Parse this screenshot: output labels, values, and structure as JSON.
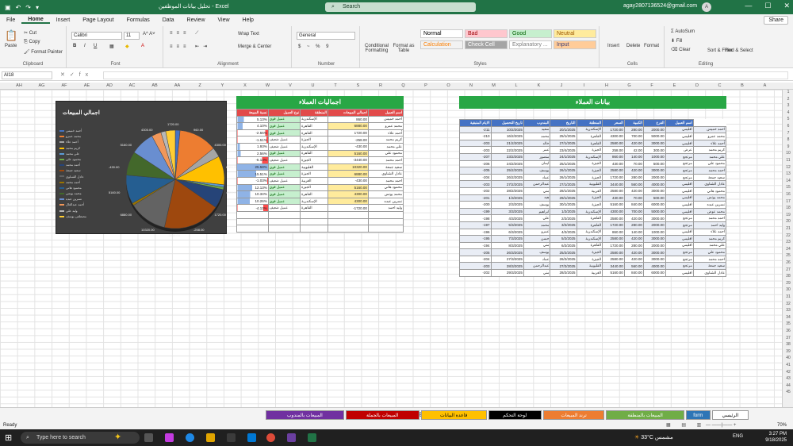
{
  "window": {
    "title": "تحليل بيانات الموظفين - Excel",
    "search": "Search",
    "account": "agay2807136524@gmail.com",
    "avatar": "A"
  },
  "menu": [
    "File",
    "Home",
    "Insert",
    "Page Layout",
    "Formulas",
    "Data",
    "Review",
    "View",
    "Help"
  ],
  "share": "Share",
  "ribbon": {
    "clipboard": {
      "label": "Clipboard",
      "paste": "Paste",
      "cut": "Cut",
      "copy": "Copy",
      "painter": "Format Painter"
    },
    "font": {
      "label": "Font",
      "name": "Calibri",
      "size": "11"
    },
    "alignment": {
      "label": "Alignment",
      "wrap": "Wrap Text",
      "merge": "Merge & Center"
    },
    "number": {
      "label": "Number",
      "format": "General",
      "symbols": "$ ~ % 9"
    },
    "styles": {
      "label": "Styles",
      "cond": "Conditional Formatting",
      "table": "Format as Table",
      "items": [
        {
          "t": "Normal",
          "bg": "#ffffff",
          "c": "#000000"
        },
        {
          "t": "Bad",
          "bg": "#ffc7ce",
          "c": "#9c0006"
        },
        {
          "t": "Good",
          "bg": "#c6efce",
          "c": "#006100"
        },
        {
          "t": "Neutral",
          "bg": "#ffeb9c",
          "c": "#9c5700"
        },
        {
          "t": "Calculation",
          "bg": "#f2f2f2",
          "c": "#fa7d00"
        },
        {
          "t": "Check Cell",
          "bg": "#a5a5a5",
          "c": "#ffffff"
        },
        {
          "t": "Explanatory ...",
          "bg": "#ffffff",
          "c": "#7f7f7f"
        },
        {
          "t": "Input",
          "bg": "#ffcc99",
          "c": "#3f3f76"
        }
      ]
    },
    "cells": {
      "label": "Cells",
      "insert": "Insert",
      "delete": "Delete",
      "format": "Format"
    },
    "editing": {
      "label": "Editing",
      "autosum": "AutoSum",
      "fill": "Fill",
      "clear": "Clear",
      "sort": "Sort & Filter",
      "find": "Find & Select"
    }
  },
  "namebox": "AI18",
  "columns": [
    "AH",
    "AG",
    "AF",
    "AE",
    "AD",
    "AC",
    "AB",
    "AA",
    "Z",
    "Y",
    "X",
    "W",
    "V",
    "U",
    "T",
    "S",
    "R",
    "Q",
    "P",
    "O",
    "N",
    "M",
    "L",
    "K",
    "J",
    "I",
    "H",
    "G",
    "F",
    "E",
    "D",
    "C",
    "B",
    "A"
  ],
  "rows": [
    "1",
    "2",
    "3",
    "4",
    "5",
    "6",
    "7",
    "8",
    "9",
    "10",
    "11",
    "12",
    "13",
    "14",
    "15",
    "16",
    "17",
    "18",
    "19",
    "20",
    "21",
    "22",
    "23",
    "24",
    "25",
    "26",
    "27",
    "28",
    "29",
    "30",
    "31",
    "32",
    "33",
    "34",
    "35",
    "36",
    "37",
    "38",
    "39",
    "40",
    "41",
    "42",
    "43",
    "44",
    "45"
  ],
  "chart": {
    "title": "اجمالي المبيعات",
    "legend": [
      "أحمد خميس",
      "محمد عمرو",
      "أحمد علاء",
      "كريم محمد",
      "علي محمد",
      "محمود علي",
      "أحمد محمد",
      "سعيد جمعة",
      "عادل الشناوي",
      "أحمد محمد",
      "محمود هاني",
      "محمد يونس",
      "نسرين عبده",
      "أحمد عبدالعال",
      "وليد علي",
      "مصطفى يوسف"
    ],
    "labels": [
      "1720.00",
      "960.00",
      "4300.00",
      "6880.00",
      "4300.00",
      "1720.00",
      "-258.00",
      "-3440.00",
      "10320.00",
      "6880.00",
      "5160.00",
      "-430.00",
      "5160.00",
      "4300.00"
    ]
  },
  "chart_data": {
    "type": "pie",
    "title": "اجمالي المبيعات",
    "categories": [
      "1",
      "2",
      "3",
      "4",
      "5",
      "6",
      "7",
      "8",
      "9",
      "10",
      "11",
      "12",
      "13",
      "14",
      "15",
      "16"
    ],
    "values": [
      860,
      6880,
      1720,
      5160,
      430,
      430,
      3440,
      10320,
      6880,
      430,
      5160,
      4300,
      4300,
      1720,
      860,
      1720
    ]
  },
  "summary": {
    "title": "اجماليات العملاء",
    "headers": [
      "اسم العميل",
      "اجمالي المبيعات",
      "المنطقة",
      "نوع العميل",
      "نسبة المبيعة"
    ],
    "rows": [
      [
        "احمد خميس",
        "860.00",
        "الإسكندرية",
        "عميل قوي",
        "5.13%"
      ],
      [
        "محمد عمرو",
        "6880.00",
        "القاهرة",
        "عميل قوي",
        "4.10%"
      ],
      [
        "أحمد علاء",
        "1720.00",
        "القاهرة",
        "عميل قوي",
        "-2.56%"
      ],
      [
        "كريم محمد",
        "-258.00",
        "الجيزة",
        "عميل ضعيف",
        "-1.51%"
      ],
      [
        "علي محمد",
        "-430.00",
        "الإسكندرية",
        "عميل ضعيف",
        "1.93%"
      ],
      [
        "محمود علي",
        "5160.00",
        "القاهرة",
        "عميل قوي",
        "2.56%"
      ],
      [
        "احمد محمد",
        "-3440.00",
        "الجيزة",
        "عميل ضعيف",
        "-5.13%"
      ],
      [
        "سعيد جمعة",
        "10320.00",
        "القليوبية",
        "عميل قوي",
        "25.58%"
      ],
      [
        "عادل الشناوي",
        "6880.00",
        "الجيزة",
        "عميل قوي",
        "15.51%"
      ],
      [
        "احمد محمد",
        "-430.00",
        "الغربية",
        "عميل ضعيف",
        "-1.03%"
      ],
      [
        "محمود هاني",
        "5160.00",
        "الجيزة",
        "عميل قوي",
        "12.13%"
      ],
      [
        "محمد يونس",
        "4300.00",
        "القاهرة",
        "عميل قوي",
        "10.34%"
      ],
      [
        "نسرين عبده",
        "4300.00",
        "الإسكندرية",
        "عميل قوي",
        "10.26%"
      ],
      [
        "وليد احمد",
        "-1720.00",
        "القاهرة",
        "عميل ضعيف",
        "-4.13%"
      ]
    ]
  },
  "customers": {
    "title": "بيانات العملاء",
    "headers": [
      "اسم العميل",
      "الفرع",
      "الكمية",
      "السعر",
      "المنطقة",
      "التاريخ",
      "المندوب",
      "تاريخ التحصيل",
      "الايام المتبقية"
    ],
    "rows": [
      [
        "احمد خميس",
        "اقليمي",
        "2000.00",
        "280.00",
        "1720.00",
        "الإسكندرية",
        "20/1/2025",
        "سعيد",
        "10/2/2025",
        "-211"
      ],
      [
        "محمد عمرو",
        "اقليمي",
        "5000.00",
        "700.00",
        "4300.00",
        "القاهرة",
        "25/1/2025",
        "محمد",
        "16/2/2025",
        "-210"
      ],
      [
        "أحمد علاء",
        "اقليمي",
        "3000.00",
        "420.00",
        "2580.00",
        "القاهرة",
        "27/1/2025",
        "خالد",
        "21/2/2025",
        "-203"
      ],
      [
        "كريم محمد",
        "عرض",
        "300.00",
        "42.00",
        "258.00",
        "الجيزة",
        "23/4/2025",
        "عمر",
        "22/2/2025",
        "-203"
      ],
      [
        "علي محمد",
        "مرتجع",
        "1000.00",
        "140.00",
        "860.00",
        "الإسكندرية",
        "24/1/2025",
        "منصور",
        "23/2/2025",
        "-207"
      ],
      [
        "محمود علي",
        "مرتجع",
        "500.00",
        "70.00",
        "430.00",
        "الجيزة",
        "25/1/2025",
        "ايمان",
        "24/2/2025",
        "-206"
      ],
      [
        "احمد محمد",
        "مرتجع",
        "3000.00",
        "420.00",
        "2580.00",
        "الجيزة",
        "26/1/2025",
        "يوسف",
        "25/2/2025",
        "-205"
      ],
      [
        "سعيد جمعة",
        "مرتجع",
        "2000.00",
        "280.00",
        "1720.00",
        "الجيزة",
        "26/1/2025",
        "عماد",
        "26/2/2025",
        "-204"
      ],
      [
        "عادل الشناوي",
        "اقليمي",
        "4000.00",
        "560.00",
        "3440.00",
        "القليوبية",
        "27/1/2025",
        "عبدالرحمن",
        "27/2/2025",
        "-203"
      ],
      [
        "محمود هاني",
        "اقليمي",
        "3000.00",
        "420.00",
        "2580.00",
        "الغربية",
        "28/1/2025",
        "مني",
        "28/2/2025",
        "-202"
      ],
      [
        "محمد يونس",
        "اقليمي",
        "500.00",
        "70.00",
        "430.00",
        "الجيزة",
        "29/1/2025",
        "هبه",
        "1/3/2025",
        "-201"
      ],
      [
        "نسرين عبده",
        "اقليمي",
        "6000.00",
        "840.00",
        "5160.00",
        "الجيزة",
        "30/1/2025",
        "يوسف",
        "2/3/2025",
        "-200"
      ],
      [
        "محمد عوض",
        "اقليمي",
        "5000.00",
        "700.00",
        "4300.00",
        "الإسكندرية",
        "1/2/2025",
        "ابراهيم",
        "3/3/2025",
        "-199"
      ],
      [
        "احمد محمد",
        "مرتجع",
        "3000.00",
        "420.00",
        "2580.00",
        "القاهرة",
        "2/2/2025",
        "علي",
        "4/3/2025",
        "-198"
      ],
      [
        "وليد احمد",
        "مرتجع",
        "2000.00",
        "280.00",
        "1720.00",
        "القاهرة",
        "3/2/2025",
        "محمد",
        "5/3/2025",
        "-197"
      ],
      [
        "احمد علاء",
        "اقليمي",
        "1000.00",
        "140.00",
        "860.00",
        "الإسكندرية",
        "4/2/2025",
        "عمرو",
        "6/3/2025",
        "-196"
      ],
      [
        "كريم محمد",
        "اقليمي",
        "3000.00",
        "420.00",
        "2580.00",
        "الإسكندرية",
        "5/2/2025",
        "حسن",
        "7/3/2025",
        "-195"
      ],
      [
        "علي محمد",
        "اقليمي",
        "2000.00",
        "280.00",
        "1720.00",
        "القاهرة",
        "6/2/2025",
        "مني",
        "8/3/2025",
        "-194"
      ],
      [
        "محمود علي",
        "مرتجع",
        "3000.00",
        "420.00",
        "2580.00",
        "الجيزة",
        "25/2/2025",
        "يوسف",
        "26/3/2025",
        "-205"
      ],
      [
        "احمد محمد",
        "مرتجع",
        "3000.00",
        "420.00",
        "2580.00",
        "الجيزة",
        "26/2/2025",
        "عماد",
        "27/3/2025",
        "-204"
      ],
      [
        "سعيد جمعة",
        "مرتجع",
        "4000.00",
        "560.00",
        "3440.00",
        "القليوبية",
        "27/2/2025",
        "عبدالرحمن",
        "28/3/2025",
        "-203"
      ],
      [
        "عادل الشناوي",
        "اقليمي",
        "6000.00",
        "840.00",
        "5160.00",
        "الغربية",
        "28/2/2025",
        "مني",
        "29/3/2025",
        "-202"
      ]
    ]
  },
  "tabs": [
    {
      "t": "الرئيسي",
      "bg": "#ffffff",
      "c": "#000"
    },
    {
      "t": "form",
      "bg": "#2e75b6",
      "c": "#fff"
    },
    {
      "t": "المبيعات بالمنطقة",
      "bg": "#70ad47",
      "c": "#fff"
    },
    {
      "t": "ترند المبيعات",
      "bg": "#ed7d31",
      "c": "#fff"
    },
    {
      "t": "لوحة التحكم",
      "bg": "#000000",
      "c": "#fff"
    },
    {
      "t": "قاعدة البيانات",
      "bg": "#ffc000",
      "c": "#000"
    },
    {
      "t": "المبيعات بالجملة",
      "bg": "#c00000",
      "c": "#fff"
    },
    {
      "t": "المبيعات بالمندوب",
      "bg": "#7030a0",
      "c": "#fff"
    }
  ],
  "status": {
    "ready": "Ready",
    "zoom": "70%"
  },
  "taskbar": {
    "search": "Type here to search",
    "weather": "33°C",
    "weather_text": "مشمس",
    "lang": "ENG",
    "time": "3:27 PM",
    "date": "9/18/2025"
  }
}
